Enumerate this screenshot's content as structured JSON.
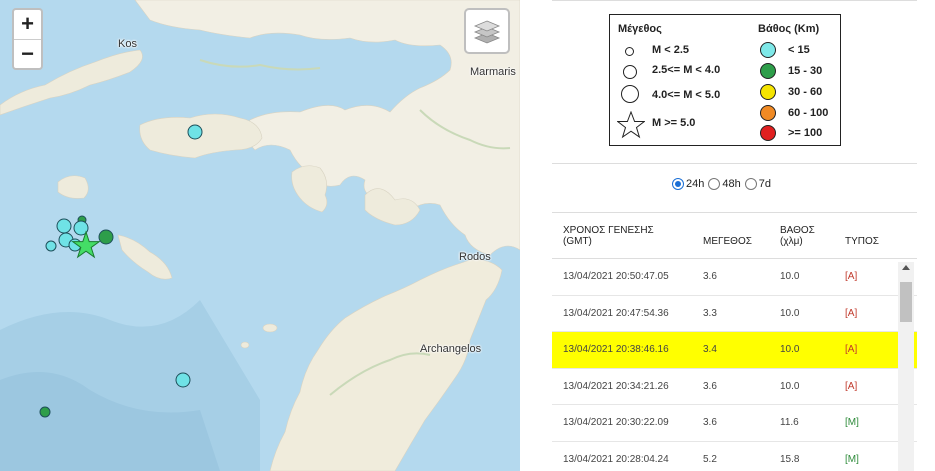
{
  "map": {
    "zoom_in": "+",
    "zoom_out": "−",
    "layers_icon": "layers-icon",
    "places": [
      "Kos",
      "Marmaris",
      "Rodos",
      "Archangelos"
    ]
  },
  "legend": {
    "magnitude_title": "Μέγεθος",
    "depth_title": "Βάθος (Km)",
    "magnitude_items": [
      "M < 2.5",
      "2.5<= M < 4.0",
      "4.0<= M < 5.0",
      "M >= 5.0"
    ],
    "depth_items": [
      {
        "label": "< 15",
        "color": "#7ee8e8"
      },
      {
        "label": "15 - 30",
        "color": "#2e9e4a"
      },
      {
        "label": "30 - 60",
        "color": "#f5e400"
      },
      {
        "label": "60 - 100",
        "color": "#f08a24"
      },
      {
        "label": ">= 100",
        "color": "#e02020"
      }
    ]
  },
  "period": {
    "options": [
      "24h",
      "48h",
      "7d"
    ],
    "selected": "24h"
  },
  "table": {
    "headers": {
      "time": "ΧΡΟΝΟΣ ΓΕΝΕΣΗΣ",
      "time_sub": "(GMT)",
      "mag": "ΜΕΓΕΘΟΣ",
      "depth": "ΒΑΘΟΣ",
      "depth_sub": "(χλμ)",
      "type": "ΤΥΠΟΣ"
    },
    "rows": [
      {
        "time": "13/04/2021 20:50:47.05",
        "mag": "3.6",
        "depth": "10.0",
        "type": "[A]"
      },
      {
        "time": "13/04/2021 20:47:54.36",
        "mag": "3.3",
        "depth": "10.0",
        "type": "[A]"
      },
      {
        "time": "13/04/2021 20:38:46.16",
        "mag": "3.4",
        "depth": "10.0",
        "type": "[A]"
      },
      {
        "time": "13/04/2021 20:34:21.26",
        "mag": "3.6",
        "depth": "10.0",
        "type": "[A]"
      },
      {
        "time": "13/04/2021 20:30:22.09",
        "mag": "3.6",
        "depth": "11.6",
        "type": "[M]"
      },
      {
        "time": "13/04/2021 20:28:04.24",
        "mag": "5.2",
        "depth": "15.8",
        "type": "[M]"
      }
    ]
  }
}
